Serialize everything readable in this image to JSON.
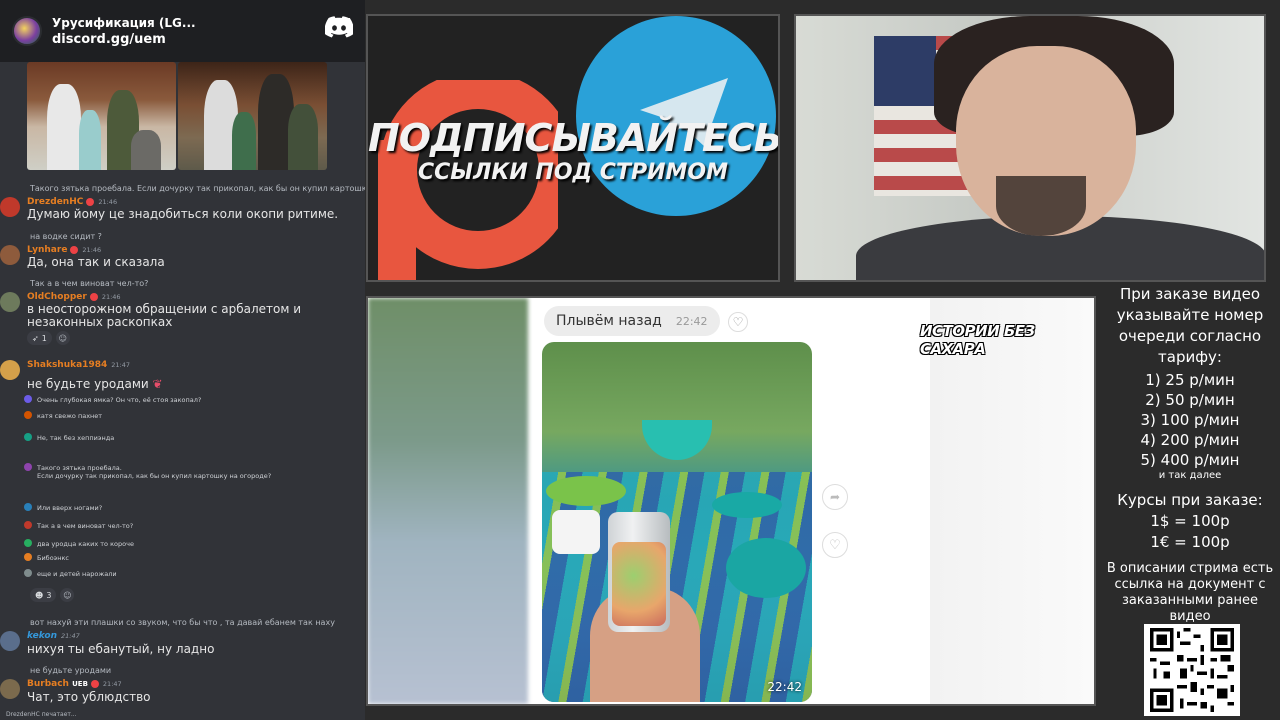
{
  "server": {
    "name": "Урусификация (LG...",
    "invite": "discord.gg/uem"
  },
  "messages": [
    {
      "reply_name": "",
      "reply_text": "Такого зятька проебала. Если дочурку так прикопал, как бы он купил картошку на огороде?",
      "name": "DrezdenHC",
      "time": "21:46",
      "text": "Думаю йому це знадобиться коли окопи ритиме."
    },
    {
      "reply_name": "",
      "reply_text": "на водке сидит ?",
      "name": "Lynhare",
      "time": "21:46",
      "text": "Да, она так и сказала"
    },
    {
      "reply_name": "",
      "reply_text": "Так а в чем виноват чел-то?",
      "name": "OldChopper",
      "time": "21:46",
      "text": "в неосторожном обращении с арбалетом и незаконных раскопках",
      "react_count": "1"
    },
    {
      "reply_name": "",
      "reply_text": "",
      "name": "Shakshuka1984",
      "time": "21:47",
      "text": "не будьте уродами"
    },
    {
      "reply_name": "",
      "reply_text": "вот нахуй эти плашки со звуком, что бы что , та давай ебанем так наху",
      "name": "kekon",
      "time": "21:47",
      "text": "нихуя ты ебанутый, ну ладно"
    },
    {
      "reply_name": "",
      "reply_text": "не будьте уродами",
      "name": "Burbach",
      "tag": "UEB",
      "time": "21:47",
      "text": "Чат, это ублюдство"
    }
  ],
  "sub_messages": [
    "Очень глубокая ямка? Он что, её стоя закопал?",
    "катя свежо пахнет",
    "Не, так без хеппиэнда",
    "Такого зятька проебала.\nЕсли дочурку так прикопал, как бы он купил картошку на огороде?",
    "Или вверх ногами?",
    "Так а в чем виноват чел-то?",
    "два уродца каких то короче",
    "Бибоэнкс",
    "еще и детей нарожали"
  ],
  "sub_react_count": "3",
  "typing": "DrezdenHC печатает...",
  "promo": {
    "line1": "ПОДПИСЫВАЙТЕСЬ",
    "line2": "ССЫЛКИ ПОД СТРИМОМ"
  },
  "video": {
    "message": "Плывём назад",
    "message_time": "22:42",
    "photo_time": "22:42",
    "watermark": "ИСТОРИИ БЕЗ САХАРА"
  },
  "info": {
    "title": "При заказе видео указывайте номер очереди согласно тарифу:",
    "tiers": [
      "1) 25 р/мин",
      "2) 50 р/мин",
      "3) 100 р/мин",
      "4) 200 р/мин",
      "5) 400 р/мин"
    ],
    "etc": "и так далее",
    "rates_title": "Курсы при заказе:",
    "rate_usd": "1$ = 100р",
    "rate_eur": "1€ = 100р",
    "note": "В описании стрима есть ссылка на документ с заказанными ранее видео"
  },
  "colors": {
    "discord_bg": "#313338",
    "username": "#e67e22",
    "telegram": "#2aa1d8",
    "patreon": "#e8563f"
  }
}
